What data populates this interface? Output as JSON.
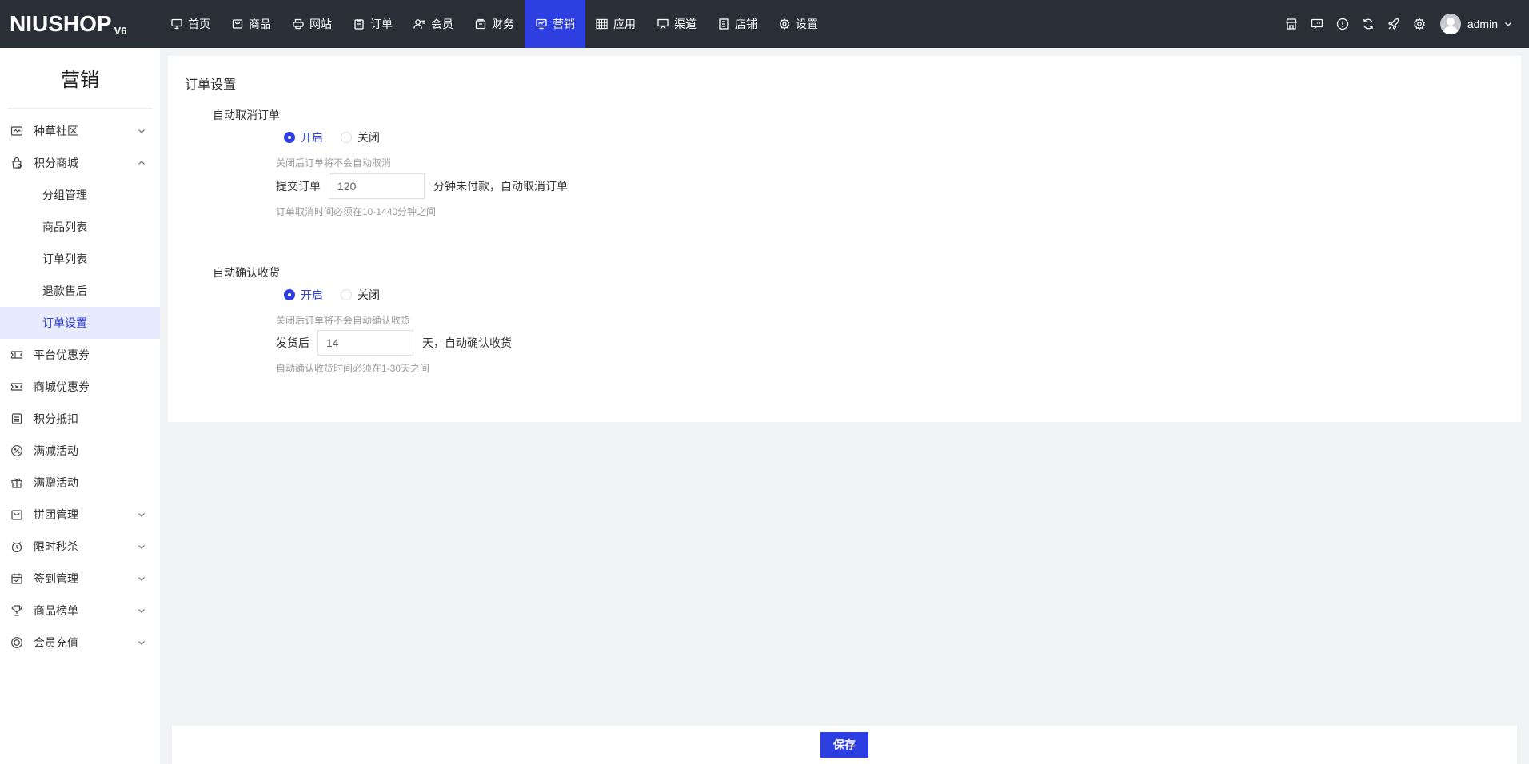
{
  "logo": {
    "brand": "NIUSHOP",
    "version": "V6"
  },
  "nav": [
    {
      "label": "首页",
      "icon": "monitor-icon"
    },
    {
      "label": "商品",
      "icon": "box-icon"
    },
    {
      "label": "网站",
      "icon": "printer-icon"
    },
    {
      "label": "订单",
      "icon": "clipboard-icon"
    },
    {
      "label": "会员",
      "icon": "user-icon"
    },
    {
      "label": "财务",
      "icon": "wallet-icon"
    },
    {
      "label": "营销",
      "icon": "marketing-icon",
      "active": true
    },
    {
      "label": "应用",
      "icon": "grid-icon"
    },
    {
      "label": "渠道",
      "icon": "screen-icon"
    },
    {
      "label": "店铺",
      "icon": "store-icon"
    },
    {
      "label": "设置",
      "icon": "gear-icon"
    }
  ],
  "top_right": {
    "icons": [
      "shop-icon",
      "message-icon",
      "info-icon",
      "refresh-icon",
      "rocket-icon",
      "gear-icon"
    ],
    "user": "admin"
  },
  "sidebar": {
    "title": "营销",
    "items": [
      {
        "label": "种草社区",
        "icon": "community-icon",
        "arrow": "down"
      },
      {
        "label": "积分商城",
        "icon": "points-mall-icon",
        "arrow": "up",
        "children": [
          "分组管理",
          "商品列表",
          "订单列表",
          "退款售后",
          "订单设置"
        ],
        "active_child": 4
      },
      {
        "label": "平台优惠券",
        "icon": "coupon-icon"
      },
      {
        "label": "商城优惠券",
        "icon": "ticket-icon"
      },
      {
        "label": "积分抵扣",
        "icon": "deduct-icon"
      },
      {
        "label": "满减活动",
        "icon": "discount-icon"
      },
      {
        "label": "满赠活动",
        "icon": "gift-icon"
      },
      {
        "label": "拼团管理",
        "icon": "bag-icon",
        "arrow": "down"
      },
      {
        "label": "限时秒杀",
        "icon": "clock-icon",
        "arrow": "down"
      },
      {
        "label": "签到管理",
        "icon": "calendar-icon",
        "arrow": "down"
      },
      {
        "label": "商品榜单",
        "icon": "trophy-icon",
        "arrow": "down"
      },
      {
        "label": "会员充值",
        "icon": "recharge-icon",
        "arrow": "down"
      }
    ]
  },
  "main": {
    "title": "订单设置",
    "auto_cancel": {
      "label": "自动取消订单",
      "on": "开启",
      "off": "关闭",
      "hint1": "关闭后订单将不会自动取消",
      "prefix": "提交订单",
      "value": "120",
      "suffix": "分钟未付款，自动取消订单",
      "hint2": "订单取消时间必须在10-1440分钟之间"
    },
    "auto_confirm": {
      "label": "自动确认收货",
      "on": "开启",
      "off": "关闭",
      "hint1": "关闭后订单将不会自动确认收货",
      "prefix": "发货后",
      "value": "14",
      "suffix": "天，自动确认收货",
      "hint2": "自动确认收货时间必须在1-30天之间"
    }
  },
  "footer": {
    "save_label": "保存"
  },
  "colors": {
    "primary": "#2d3fe0",
    "topbar": "#2a2e37"
  }
}
